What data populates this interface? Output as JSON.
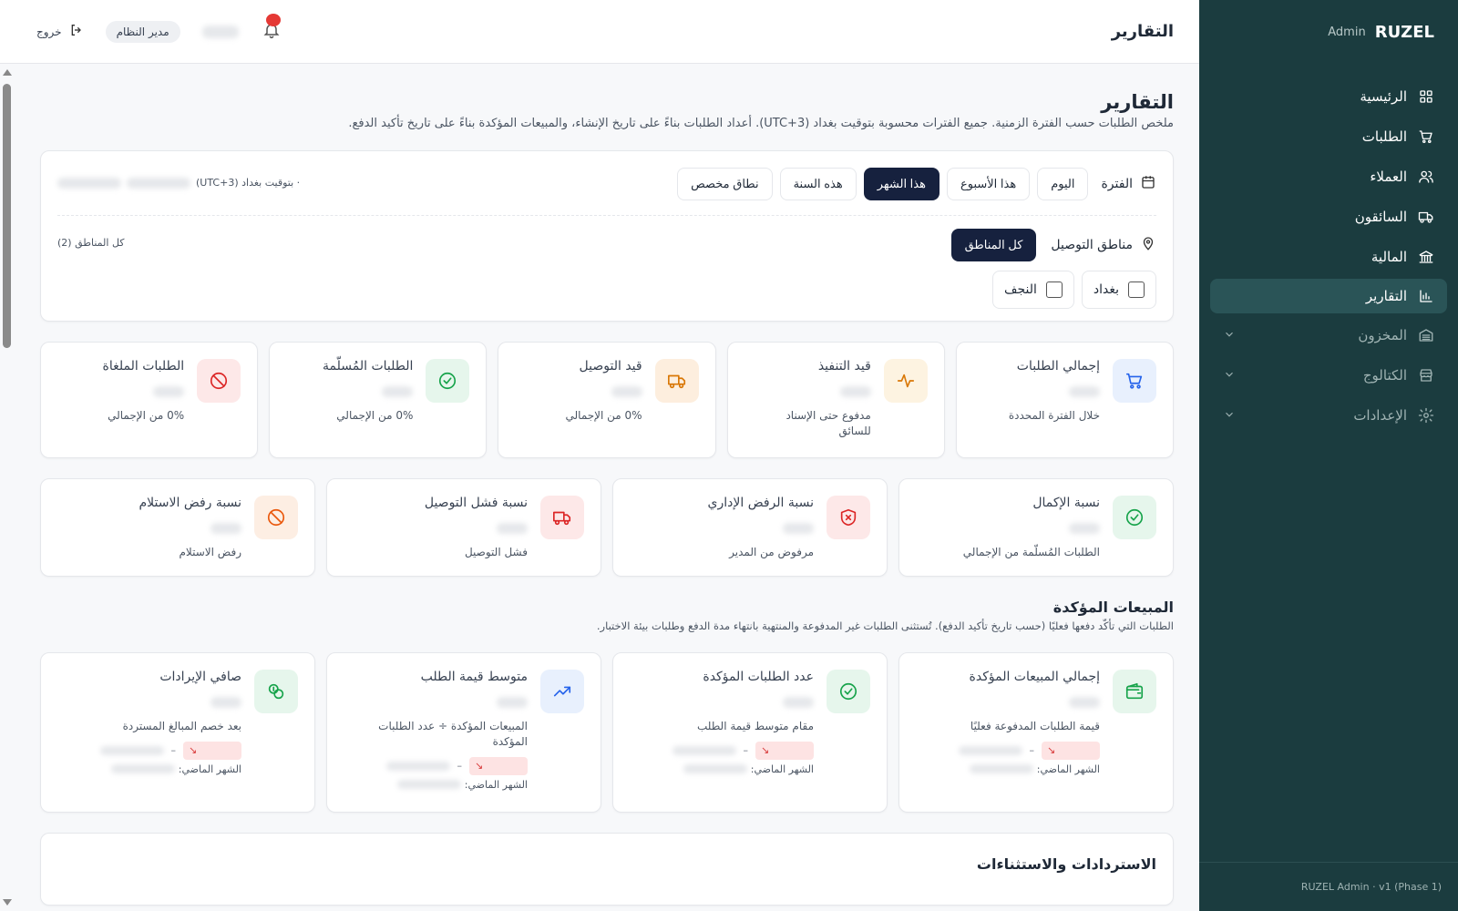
{
  "brand": {
    "name": "RUZEL",
    "sub": "Admin"
  },
  "nav": [
    {
      "label": "الرئيسية",
      "icon": "grid-icon",
      "active": false,
      "dim": false,
      "chevron": false
    },
    {
      "label": "الطلبات",
      "icon": "cart-icon",
      "active": false,
      "dim": false,
      "chevron": false
    },
    {
      "label": "العملاء",
      "icon": "users-icon",
      "active": false,
      "dim": false,
      "chevron": false
    },
    {
      "label": "السائقون",
      "icon": "truck-icon",
      "active": false,
      "dim": false,
      "chevron": false
    },
    {
      "label": "المالية",
      "icon": "bank-icon",
      "active": false,
      "dim": false,
      "chevron": false
    },
    {
      "label": "التقارير",
      "icon": "bar-chart-icon",
      "active": true,
      "dim": false,
      "chevron": false
    },
    {
      "label": "المخزون",
      "icon": "warehouse-icon",
      "active": false,
      "dim": true,
      "chevron": true
    },
    {
      "label": "الكتالوج",
      "icon": "store-icon",
      "active": false,
      "dim": true,
      "chevron": true
    },
    {
      "label": "الإعدادات",
      "icon": "gear-icon",
      "active": false,
      "dim": true,
      "chevron": true
    }
  ],
  "sidebar_footer": "RUZEL Admin · v1 (Phase 1)",
  "topbar": {
    "title": "التقارير",
    "role": "مدير النظام",
    "logout": "خروج"
  },
  "page": {
    "title": "التقارير",
    "desc": "ملخص الطلبات حسب الفترة الزمنية. جميع الفترات محسوبة بتوقيت بغداد (UTC+3). أعداد الطلبات بناءً على تاريخ الإنشاء، والمبيعات المؤكدة بناءً على تاريخ تأكيد الدفع."
  },
  "filters": {
    "period_label": "الفترة",
    "periods": [
      "اليوم",
      "هذا الأسبوع",
      "هذا الشهر",
      "هذه السنة",
      "نطاق مخصص"
    ],
    "active_period": "هذا الشهر",
    "tz_note": "· بتوقيت بغداد (UTC+3)",
    "regions_label": "مناطق التوصيل",
    "all_regions": "كل المناطق",
    "regions_count": "كل المناطق (2)",
    "regions": [
      "بغداد",
      "النجف"
    ]
  },
  "stats_row1": [
    {
      "label": "إجمالي الطلبات",
      "sub": "خلال الفترة المحددة",
      "icon": "cart-icon",
      "color": "#2563eb",
      "bg": "#e8f0fd"
    },
    {
      "label": "قيد التنفيذ",
      "sub": "مدفوع حتى الإسناد للسائق",
      "icon": "activity-icon",
      "color": "#d97706",
      "bg": "#fdf3e1"
    },
    {
      "label": "قيد التوصيل",
      "sub": "0% من الإجمالي",
      "icon": "truck-icon",
      "color": "#d97706",
      "bg": "#fdeede"
    },
    {
      "label": "الطلبات المُسلّمة",
      "sub": "0% من الإجمالي",
      "icon": "check-circle-icon",
      "color": "#16a34a",
      "bg": "#e6f6ec"
    },
    {
      "label": "الطلبات الملغاة",
      "sub": "0% من الإجمالي",
      "icon": "ban-icon",
      "color": "#dc2626",
      "bg": "#fde8e8"
    }
  ],
  "stats_row2": [
    {
      "label": "نسبة الإكمال",
      "sub": "الطلبات المُسلّمة من الإجمالي",
      "icon": "check-circle-icon",
      "color": "#16a34a",
      "bg": "#e6f6ec"
    },
    {
      "label": "نسبة الرفض الإداري",
      "sub": "مرفوض من المدير",
      "icon": "shield-x-icon",
      "color": "#dc2626",
      "bg": "#fde8e8"
    },
    {
      "label": "نسبة فشل التوصيل",
      "sub": "فشل التوصيل",
      "icon": "truck-icon",
      "color": "#dc2626",
      "bg": "#fde8e8"
    },
    {
      "label": "نسبة رفض الاستلام",
      "sub": "رفض الاستلام",
      "icon": "ban-icon",
      "color": "#ea580c",
      "bg": "#fdeee3"
    }
  ],
  "sales_section": {
    "title": "المبيعات المؤكدة",
    "desc": "الطلبات التي تأكّد دفعها فعليًا (حسب تاريخ تأكيد الدفع). تُستثنى الطلبات غير المدفوعة والمنتهية بانتهاء مدة الدفع وطلبات بيئة الاختبار.",
    "prev_label": "الشهر الماضي:",
    "cards": [
      {
        "label": "إجمالي المبيعات المؤكدة",
        "sub": "قيمة الطلبات المدفوعة فعليًا",
        "icon": "wallet-icon",
        "color": "#16a34a",
        "bg": "#e6f6ec"
      },
      {
        "label": "عدد الطلبات المؤكدة",
        "sub": "مقام متوسط قيمة الطلب",
        "icon": "check-circle-icon",
        "color": "#16a34a",
        "bg": "#e6f6ec"
      },
      {
        "label": "متوسط قيمة الطلب",
        "sub": "المبيعات المؤكدة ÷ عدد الطلبات المؤكدة",
        "icon": "trending-up-icon",
        "color": "#2563eb",
        "bg": "#e8f0fd"
      },
      {
        "label": "صافي الإيرادات",
        "sub": "بعد خصم المبالغ المستردة",
        "icon": "coins-icon",
        "color": "#16a34a",
        "bg": "#e6f6ec"
      }
    ]
  },
  "refunds": {
    "title": "الاستردادات والاستثناءات"
  }
}
